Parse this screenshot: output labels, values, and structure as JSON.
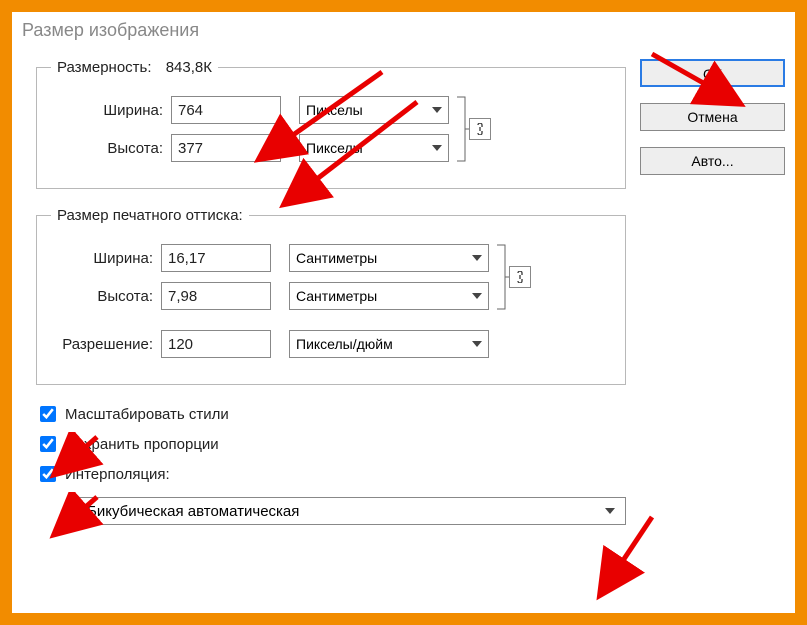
{
  "title": "Размер изображения",
  "buttons": {
    "ok": "ОК",
    "cancel": "Отмена",
    "auto": "Авто..."
  },
  "dimensions": {
    "legend": "Размерность:",
    "size": "843,8К",
    "width_label": "Ширина:",
    "width_value": "764",
    "width_unit": "Пикселы",
    "height_label": "Высота:",
    "height_value": "377",
    "height_unit": "Пикселы"
  },
  "print": {
    "legend": "Размер печатного оттиска:",
    "width_label": "Ширина:",
    "width_value": "16,17",
    "width_unit": "Сантиметры",
    "height_label": "Высота:",
    "height_value": "7,98",
    "height_unit": "Сантиметры",
    "resolution_label": "Разрешение:",
    "resolution_value": "120",
    "resolution_unit": "Пикселы/дюйм"
  },
  "options": {
    "scale_styles": "Масштабировать стили",
    "constrain": "Сохранить пропорции",
    "interp": "Интерполяция:",
    "interp_method": "Бикубическая автоматическая"
  }
}
